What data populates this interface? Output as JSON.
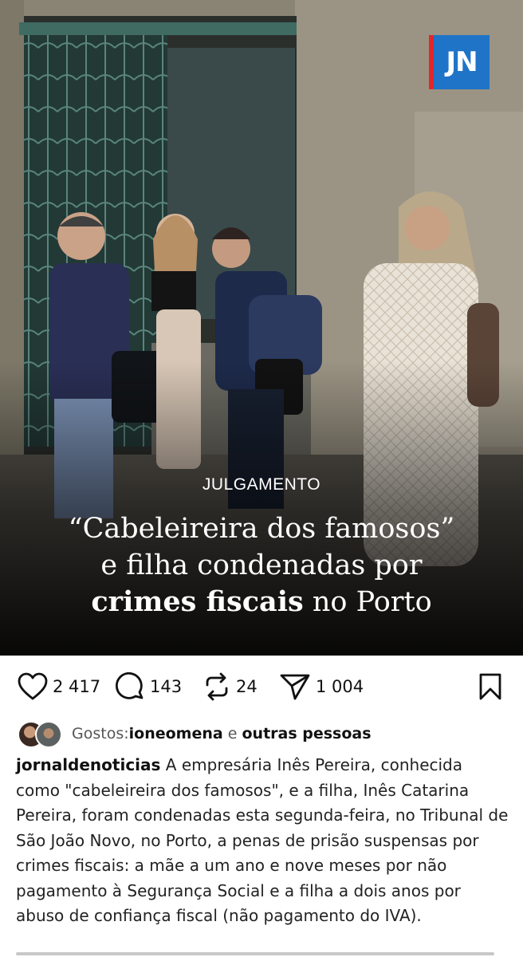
{
  "post": {
    "logo_text": "JN",
    "kicker": "JULGAMENTO",
    "headline": {
      "line1": "“Cabeleireira dos famosos”",
      "line2": "e filha condenadas por",
      "line3_bold": "crimes fiscais",
      "line3_rest": " no Porto"
    }
  },
  "actions": {
    "likes": "2 417",
    "comments": "143",
    "reposts": "24",
    "shares": "1 004",
    "icons": [
      "heart-icon",
      "comment-icon",
      "repost-icon",
      "share-icon",
      "bookmark-icon"
    ]
  },
  "likes_line": {
    "label": "Gostos: ",
    "user": "ioneomena",
    "connector": " e ",
    "others": "outras pessoas"
  },
  "caption": {
    "username": "jornaldenoticias",
    "text": " A empresária Inês Pereira, conhecida como \"cabeleireira dos famosos\", e a filha, Inês Catarina Pereira, foram condenadas esta segunda-feira, no Tribunal de São João Novo, no Porto, a penas de prisão suspensas por crimes fiscais: a mãe a um ano e nove meses por não pagamento à Segurança Social e a filha a dois anos por abuso de confiança fiscal (não pagamento do IVA)."
  },
  "colors": {
    "logo_blue": "#1f74c8",
    "logo_red": "#e3262b",
    "text": "#111111"
  }
}
